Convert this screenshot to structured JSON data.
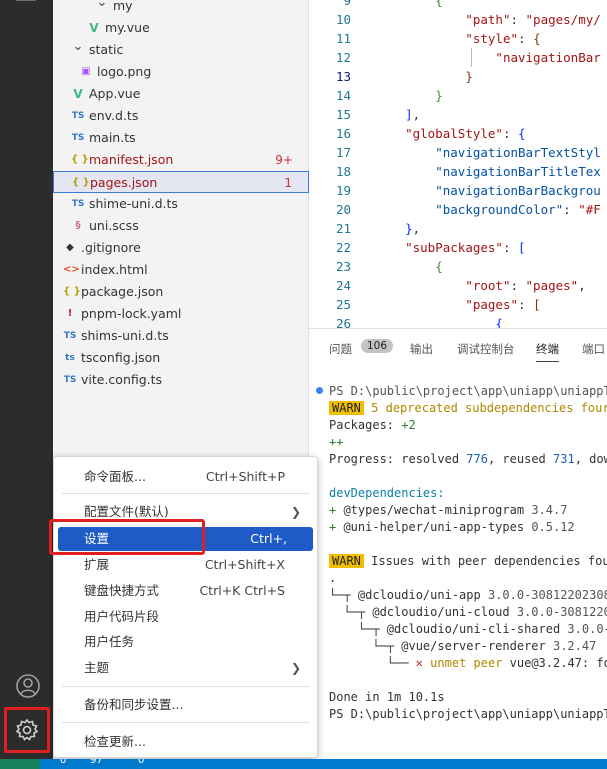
{
  "explorer": {
    "rows": [
      {
        "name": "my",
        "type": "folder",
        "indent": 50,
        "chevron": "v"
      },
      {
        "name": "my.vue",
        "type": "vue",
        "indent": 42
      },
      {
        "name": "static",
        "type": "folder",
        "indent": 26,
        "chevron": "v"
      },
      {
        "name": "logo.png",
        "type": "img",
        "indent": 34
      },
      {
        "name": "App.vue",
        "type": "vue",
        "indent": 26
      },
      {
        "name": "env.d.ts",
        "type": "ts",
        "indent": 26
      },
      {
        "name": "main.ts",
        "type": "ts",
        "indent": 26
      },
      {
        "name": "manifest.json",
        "type": "json",
        "indent": 26,
        "badge": "9+",
        "modified": true
      },
      {
        "name": "pages.json",
        "type": "json",
        "indent": 26,
        "badge": "1",
        "modified": true,
        "selected": true
      },
      {
        "name": "shime-uni.d.ts",
        "type": "ts",
        "indent": 26
      },
      {
        "name": "uni.scss",
        "type": "scss",
        "indent": 26
      },
      {
        "name": ".gitignore",
        "type": "git",
        "indent": 18
      },
      {
        "name": "index.html",
        "type": "html",
        "indent": 18
      },
      {
        "name": "package.json",
        "type": "json",
        "indent": 18
      },
      {
        "name": "pnpm-lock.yaml",
        "type": "yaml",
        "indent": 18
      },
      {
        "name": "shims-uni.d.ts",
        "type": "ts",
        "indent": 18
      },
      {
        "name": "tsconfig.json",
        "type": "tsconfig",
        "indent": 18
      },
      {
        "name": "vite.config.ts",
        "type": "ts",
        "indent": 18
      }
    ]
  },
  "editor": {
    "lines": [
      {
        "n": "9",
        "html": "        <span class='c-brace2'>{</span>"
      },
      {
        "n": "10",
        "html": "            <span class='c-key'>\"path\"</span><span class='c-punct'>: </span><span class='c-str'>\"pages/my/</span>"
      },
      {
        "n": "11",
        "html": "            <span class='c-key'>\"style\"</span><span class='c-punct'>: </span><span class='c-brace3'>{</span>"
      },
      {
        "n": "12",
        "html": "                <span class='c-key'>\"navigationBar</span>"
      },
      {
        "n": "13",
        "html": "            <span class='c-brace3'>}</span>",
        "current": true
      },
      {
        "n": "14",
        "html": "        <span class='c-brace2'>}</span>"
      },
      {
        "n": "15",
        "html": "    <span class='c-brace'>]</span><span class='c-punct'>,</span>"
      },
      {
        "n": "16",
        "html": "    <span class='c-key'>\"globalStyle\"</span><span class='c-punct'>: </span><span class='c-brace'>{</span>"
      },
      {
        "n": "17",
        "html": "        <span class='c-prop'>\"navigationBarTextStyl</span>"
      },
      {
        "n": "18",
        "html": "        <span class='c-prop'>\"navigationBarTitleTex</span>"
      },
      {
        "n": "19",
        "html": "        <span class='c-prop'>\"navigationBarBackgrou</span>"
      },
      {
        "n": "20",
        "html": "        <span class='c-prop'>\"backgroundColor\"</span><span class='c-punct'>: </span><span class='c-str'>\"#F</span>"
      },
      {
        "n": "21",
        "html": "    <span class='c-brace'>}</span><span class='c-punct'>,</span>"
      },
      {
        "n": "22",
        "html": "    <span class='c-key'>\"subPackages\"</span><span class='c-punct'>: </span><span class='c-brace'>[</span>"
      },
      {
        "n": "23",
        "html": "        <span class='c-brace2'>{</span>"
      },
      {
        "n": "24",
        "html": "            <span class='c-key'>\"root\"</span><span class='c-punct'>: </span><span class='c-str'>\"pages\"</span><span class='c-punct'>,</span>"
      },
      {
        "n": "25",
        "html": "            <span class='c-key'>\"pages\"</span><span class='c-punct'>: </span><span class='c-brace3'>[</span>"
      },
      {
        "n": "26",
        "html": "                <span class='c-brace'>{</span>"
      }
    ]
  },
  "panel": {
    "tabs": {
      "problems": "问题",
      "problems_count": "106",
      "output": "输出",
      "debug_console": "调试控制台",
      "terminal": "终端",
      "ports": "端口"
    },
    "terminal_lines": [
      "<span class='t-gray'>PS D:\\public\\project\\app\\uniapp\\uniappTe</span>",
      "<span class='t-warn-bg'>WARN</span> <span class='t-warn'>5 deprecated subdependencies four</span>",
      "Packages: <span class='t-green'>+2</span>",
      "<span class='t-green'>++</span>",
      "Progress: resolved <span class='t-blue'>776</span>, reused <span class='t-blue'>731</span>, down",
      "",
      "<span class='t-cyan'>devDependencies:</span>",
      "<span class='t-green'>+</span> @types/wechat-miniprogram <span class='t-gray'>3.4.7</span>",
      "<span class='t-green'>+</span> @uni-helper/uni-app-types <span class='t-gray'>0.5.12</span>",
      "",
      "<span class='t-warn-bg'>WARN</span> Issues with peer dependencies fou",
      ".",
      "└─┬ @dcloudio/uni-app <span class='t-gray'>3.0.0-308122023081</span>",
      "  └─┬ @dcloudio/uni-cloud <span class='t-gray'>3.0.0-30812202</span>",
      "    └─┬ @dcloudio/uni-cli-shared <span class='t-gray'>3.0.0-3</span>",
      "      └─┬ @vue/server-renderer <span class='t-gray'>3.2.47</span>",
      "        └── <span class='t-red'>✕</span> <span class='t-warn'>unmet peer</span> vue@3.2.47: fou",
      "",
      "Done in 1m 10.1s",
      "PS D:\\public\\project\\app\\uniapp\\uniappTe"
    ]
  },
  "menu": {
    "command_palette": {
      "label": "命令面板...",
      "shortcut": "Ctrl+Shift+P"
    },
    "profiles": {
      "label": "配置文件(默认)"
    },
    "settings": {
      "label": "设置",
      "shortcut": "Ctrl+,"
    },
    "extensions": {
      "label": "扩展",
      "shortcut": "Ctrl+Shift+X"
    },
    "keyboard_shortcuts": {
      "label": "键盘快捷方式",
      "shortcut": "Ctrl+K Ctrl+S"
    },
    "user_snippets": {
      "label": "用户代码片段"
    },
    "user_tasks": {
      "label": "用户任务"
    },
    "themes": {
      "label": "主题"
    },
    "backup_sync": {
      "label": "备份和同步设置..."
    },
    "check_updates": {
      "label": "检查更新..."
    }
  },
  "status": {
    "errors": "0",
    "warnings": "97",
    "ports": "0"
  },
  "colors": {
    "activity_bar": "#2c2c2c",
    "status_bar": "#007acc",
    "menu_highlight": "#1f5bc6",
    "annotation_red": "#e02020"
  }
}
